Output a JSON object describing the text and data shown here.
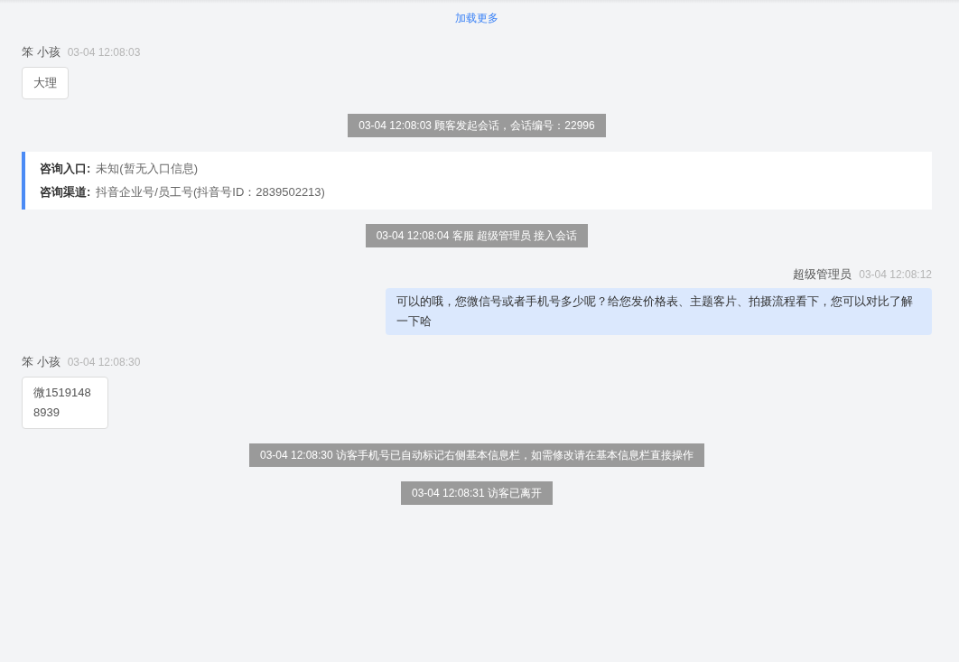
{
  "load_more": "加载更多",
  "messages": [
    {
      "kind": "visitor",
      "name": "笨 小孩",
      "time": "03-04 12:08:03",
      "text": "大理"
    },
    {
      "kind": "system",
      "text": "03-04 12:08:03 顾客发起会话，会话编号：22996"
    },
    {
      "kind": "info",
      "rows": [
        {
          "label": "咨询入口:",
          "value": "未知(暂无入口信息)"
        },
        {
          "label": "咨询渠道:",
          "value": "抖音企业号/员工号(抖音号ID：2839502213)"
        }
      ]
    },
    {
      "kind": "system",
      "text": "03-04 12:08:04 客服 超级管理员 接入会话"
    },
    {
      "kind": "agent",
      "name": "超级管理员",
      "time": "03-04 12:08:12",
      "text": "可以的哦，您微信号或者手机号多少呢？给您发价格表、主题客片、拍摄流程看下，您可以对比了解一下哈"
    },
    {
      "kind": "visitor",
      "name": "笨 小孩",
      "time": "03-04 12:08:30",
      "text": "微15191488939"
    },
    {
      "kind": "system",
      "text": "03-04 12:08:30 访客手机号已自动标记右侧基本信息栏，如需修改请在基本信息栏直接操作"
    },
    {
      "kind": "system",
      "text": "03-04 12:08:31 访客已离开"
    }
  ]
}
